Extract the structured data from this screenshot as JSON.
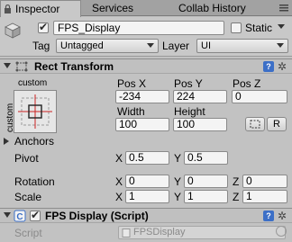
{
  "tabs": [
    {
      "label": "Inspector"
    },
    {
      "label": "Services"
    },
    {
      "label": "Collab History"
    }
  ],
  "header": {
    "name_value": "FPS_Display",
    "static_label": "Static",
    "tag_label": "Tag",
    "tag_value": "Untagged",
    "layer_label": "Layer",
    "layer_value": "UI"
  },
  "rect_transform": {
    "title": "Rect Transform",
    "anchor_preset_top": "custom",
    "anchor_preset_side": "custom",
    "pos_x_label": "Pos X",
    "pos_y_label": "Pos Y",
    "pos_z_label": "Pos Z",
    "pos_x": "-234",
    "pos_y": "224",
    "pos_z": "0",
    "width_label": "Width",
    "height_label": "Height",
    "width": "100",
    "height": "100",
    "raw_button": "R",
    "anchors_label": "Anchors",
    "pivot_label": "Pivot",
    "pivot_x": "0.5",
    "pivot_y": "0.5",
    "rotation_label": "Rotation",
    "rotation_x": "0",
    "rotation_y": "0",
    "rotation_z": "0",
    "scale_label": "Scale",
    "scale_x": "1",
    "scale_y": "1",
    "scale_z": "1",
    "x": "X",
    "y": "Y",
    "z": "Z"
  },
  "script_component": {
    "title": "FPS Display (Script)",
    "script_label": "Script",
    "script_value": "FPSDisplay"
  },
  "colors": {
    "panel": "#c2c2c2",
    "help_icon": "#3c6fc7",
    "anchor_red": "#cc2222"
  },
  "icons": [
    "lock-icon",
    "menu-icon",
    "gameobject-cube-icon",
    "rect-transform-icon",
    "help-icon",
    "gear-icon",
    "script-icon",
    "blueprint-mode-icon"
  ]
}
